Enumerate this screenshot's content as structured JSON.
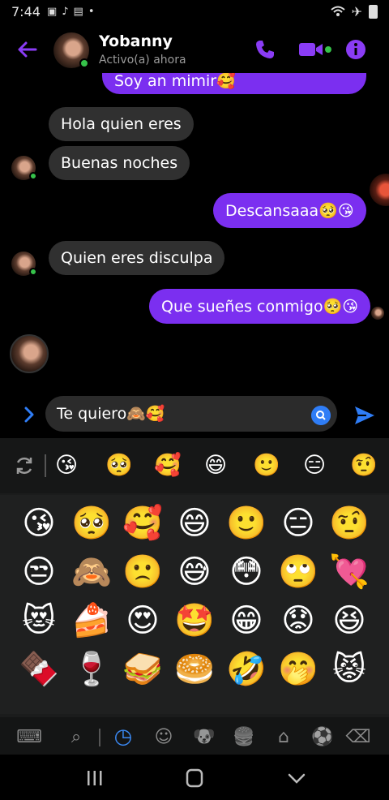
{
  "status_bar": {
    "time": "7:44",
    "left_icons": [
      "gallery-icon",
      "tiktok-icon",
      "message-icon",
      "dot-icon"
    ],
    "right_icons": [
      "wifi-icon",
      "airplane-icon",
      "battery-icon"
    ]
  },
  "header": {
    "contact_name": "Yobanny",
    "presence": "Activo(a) ahora",
    "accent_color": "#8a3cf5",
    "icons": [
      "back-arrow-icon",
      "phone-icon",
      "video-icon",
      "info-icon"
    ]
  },
  "messages": [
    {
      "direction": "out",
      "text": "Soy an mimir🥰"
    },
    {
      "direction": "in",
      "text": "Hola quien eres"
    },
    {
      "direction": "in",
      "text": "Buenas noches"
    },
    {
      "direction": "out",
      "text": "Descansaaa🥺😘"
    },
    {
      "direction": "in",
      "text": "Quien eres disculpa"
    },
    {
      "direction": "out",
      "text": "Que sueñes conmigo🥺😘"
    }
  ],
  "composer": {
    "value": "Te quiero🙈🥰",
    "icons": [
      "expand-chevron-icon",
      "emoji-search-icon",
      "send-icon"
    ]
  },
  "keyboard": {
    "recent_row": [
      "😘",
      "🥺",
      "🥰",
      "😄",
      "🙂",
      "😑",
      "🤨"
    ],
    "grid": [
      [
        "😘",
        "🥺",
        "🥰",
        "😄",
        "🙂",
        "😑",
        "🤨"
      ],
      [
        "😒",
        "🙈",
        "🙁",
        "😅",
        "😳",
        "🙄",
        "💘"
      ],
      [
        "😻",
        "🍰",
        "😍",
        "🤩",
        "😁",
        "😟",
        "😆"
      ],
      [
        "🍫",
        "🍷",
        "🥪",
        "🥯",
        "🤣",
        "🤭",
        "😾"
      ]
    ],
    "tabs": [
      {
        "icon": "keyboard-icon",
        "glyph": "⌨"
      },
      {
        "icon": "search-icon",
        "glyph": "⌕"
      },
      {
        "icon": "recent-clock-icon",
        "glyph": "◷"
      },
      {
        "icon": "smiley-icon",
        "glyph": "☺"
      },
      {
        "icon": "animal-icon",
        "glyph": "🐶"
      },
      {
        "icon": "food-icon",
        "glyph": "🍔"
      },
      {
        "icon": "home-icon",
        "glyph": "⌂"
      },
      {
        "icon": "sports-icon",
        "glyph": "⚽"
      },
      {
        "icon": "delete-icon",
        "glyph": "⌫"
      }
    ],
    "active_tab": "recent-clock-icon",
    "refresh_icon": "refresh-icon"
  },
  "nav_bar": {
    "icons": [
      "recents-icon",
      "home-icon",
      "back-icon"
    ]
  }
}
